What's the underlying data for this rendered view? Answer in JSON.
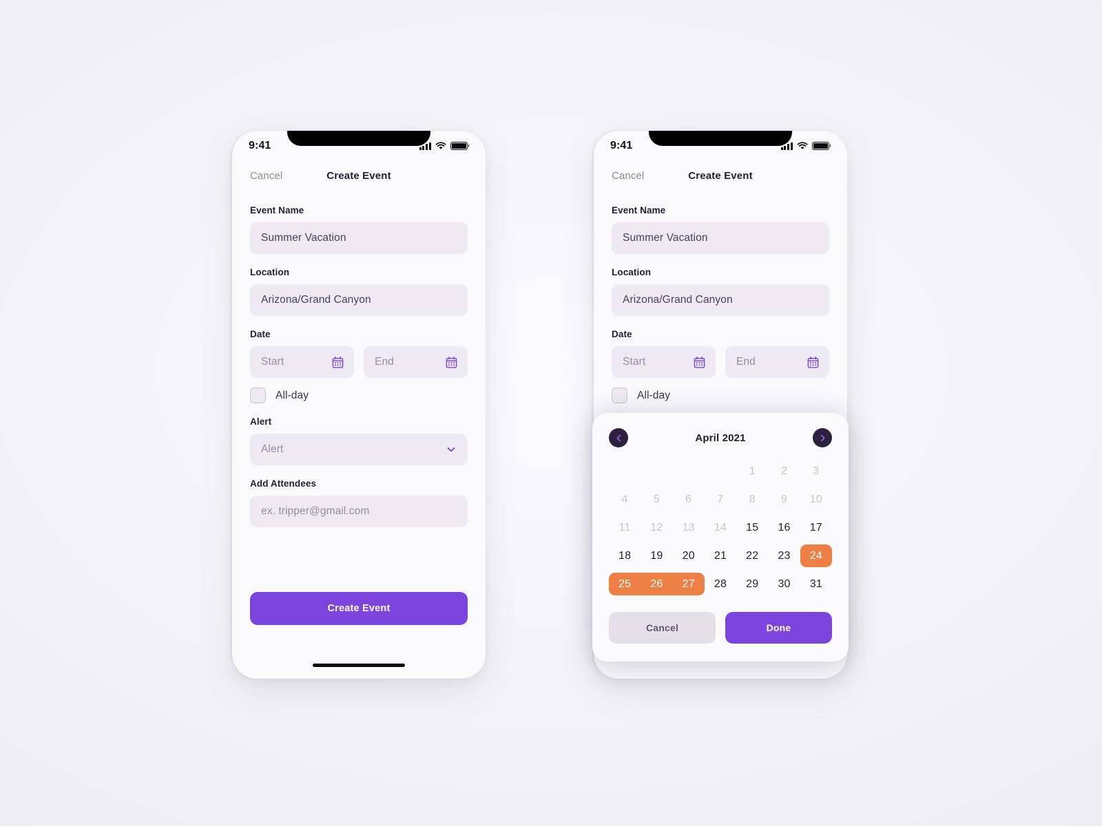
{
  "status_bar": {
    "time": "9:41",
    "signal_icon": "signal-bars-icon",
    "wifi_icon": "wifi-icon",
    "battery_icon": "battery-full-icon"
  },
  "nav": {
    "cancel_label": "Cancel",
    "title": "Create Event"
  },
  "form": {
    "event_name": {
      "label": "Event Name",
      "value": "Summer Vacation"
    },
    "location": {
      "label": "Location",
      "value": "Arizona/Grand Canyon"
    },
    "date": {
      "label": "Date",
      "start_placeholder": "Start",
      "end_placeholder": "End",
      "calendar_icon": "calendar-icon"
    },
    "allday": {
      "label": "All-day",
      "checked": false
    },
    "alert": {
      "label": "Alert",
      "placeholder": "Alert",
      "chevron_icon": "chevron-down-icon"
    },
    "attendees": {
      "label": "Add Attendees",
      "placeholder": "ex. tripper@gmail.com"
    }
  },
  "submit": {
    "label": "Create Event"
  },
  "datepicker": {
    "month_label": "April 2021",
    "prev_icon": "chevron-left-icon",
    "next_icon": "chevron-right-icon",
    "lead_blanks": 4,
    "days": [
      {
        "n": "1",
        "state": "disabled"
      },
      {
        "n": "2",
        "state": "disabled"
      },
      {
        "n": "3",
        "state": "disabled"
      },
      {
        "n": "4",
        "state": "disabled"
      },
      {
        "n": "5",
        "state": "disabled"
      },
      {
        "n": "6",
        "state": "disabled"
      },
      {
        "n": "7",
        "state": "disabled"
      },
      {
        "n": "8",
        "state": "disabled"
      },
      {
        "n": "9",
        "state": "disabled"
      },
      {
        "n": "10",
        "state": "disabled"
      },
      {
        "n": "11",
        "state": "disabled"
      },
      {
        "n": "12",
        "state": "disabled"
      },
      {
        "n": "13",
        "state": "disabled"
      },
      {
        "n": "14",
        "state": "disabled"
      },
      {
        "n": "15",
        "state": "enabled"
      },
      {
        "n": "16",
        "state": "enabled"
      },
      {
        "n": "17",
        "state": "enabled"
      },
      {
        "n": "18",
        "state": "enabled"
      },
      {
        "n": "19",
        "state": "enabled"
      },
      {
        "n": "20",
        "state": "enabled"
      },
      {
        "n": "21",
        "state": "enabled"
      },
      {
        "n": "22",
        "state": "enabled"
      },
      {
        "n": "23",
        "state": "enabled"
      },
      {
        "n": "24",
        "state": "selected-start"
      },
      {
        "n": "25",
        "state": "selected-left"
      },
      {
        "n": "26",
        "state": "selected-mid"
      },
      {
        "n": "27",
        "state": "selected-right"
      },
      {
        "n": "28",
        "state": "enabled"
      },
      {
        "n": "29",
        "state": "enabled"
      },
      {
        "n": "30",
        "state": "enabled"
      },
      {
        "n": "31",
        "state": "enabled"
      }
    ],
    "selected_range": {
      "start": "24",
      "end": "27"
    },
    "cancel_label": "Cancel",
    "done_label": "Done"
  },
  "colors": {
    "accent_purple": "#7c44dc",
    "selection_orange": "#ef8045",
    "nav_circle_dark": "#2e2140",
    "field_bg": "#edeaf3",
    "text_dark": "#241c36",
    "text_muted": "#918da2",
    "disabled_day": "#c8c4d4"
  }
}
